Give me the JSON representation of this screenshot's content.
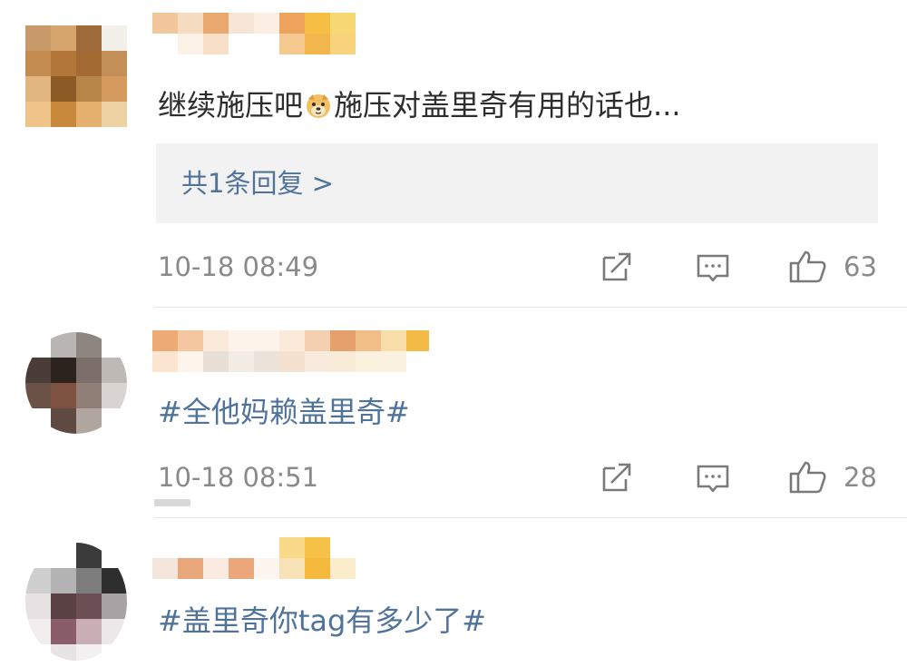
{
  "comments": [
    {
      "text": "继续施压吧",
      "emoji": "doge-emoji",
      "text_after": "施压对盖里奇有用的话也...",
      "reply_label": "共1条回复 ",
      "reply_chevron": ">",
      "time": "10-18 08:49",
      "likes": "63"
    },
    {
      "text": "#全他妈赖盖里奇#",
      "time": "10-18 08:51",
      "likes": "28"
    },
    {
      "text": "#盖里奇你tag有多少了#"
    }
  ],
  "icons": {
    "share": "share-icon",
    "comment": "comment-icon",
    "like": "thumbs-up-icon"
  },
  "colors": {
    "topic_blue": "#50739b",
    "text_dark": "#2d2d2d",
    "meta_gray": "#8a8a8a",
    "reply_bg": "#f2f2f2"
  }
}
